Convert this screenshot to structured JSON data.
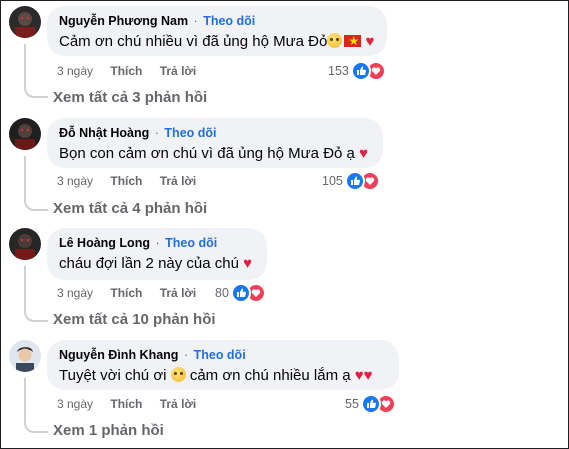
{
  "follow_label": "Theo dõi",
  "dot": "·",
  "actions": {
    "time": "3 ngày",
    "like": "Thích",
    "reply": "Trả lời"
  },
  "icons": {
    "like": "like-icon",
    "love": "love-icon"
  },
  "colors": {
    "follow": "#216fdb",
    "like": "#1877f2",
    "love": "#f33e58",
    "bubble": "#f0f2f5"
  },
  "comments": [
    {
      "author": "Nguyễn Phương Nam",
      "text": "Cảm ơn chú nhiều vì đã ủng hộ Mưa Đỏ",
      "emojis": [
        "face-emoji",
        "vietnam-flag",
        "heart"
      ],
      "reaction_count": "153",
      "replies": "Xem tất cả 3 phản hồi"
    },
    {
      "author": "Đỗ Nhật Hoàng",
      "text": "Bọn con cảm ơn chú vì đã ủng hộ Mưa Đỏ ạ",
      "emojis": [
        "heart"
      ],
      "reaction_count": "105",
      "replies": "Xem tất cả 4 phản hồi"
    },
    {
      "author": "Lê Hoàng Long",
      "text": "cháu đợi lần 2 này của chú",
      "emojis": [
        "heart"
      ],
      "reaction_count": "80",
      "replies": "Xem tất cả 10 phản hồi"
    },
    {
      "author": "Nguyễn Đình Khang",
      "text_before": "Tuyệt vời chú ơi",
      "text_after": "cảm ơn chú nhiều lắm ạ",
      "emojis": [
        "pleading-face-emoji",
        "heart",
        "heart"
      ],
      "reaction_count": "55",
      "replies": "Xem 1 phản hồi"
    }
  ]
}
